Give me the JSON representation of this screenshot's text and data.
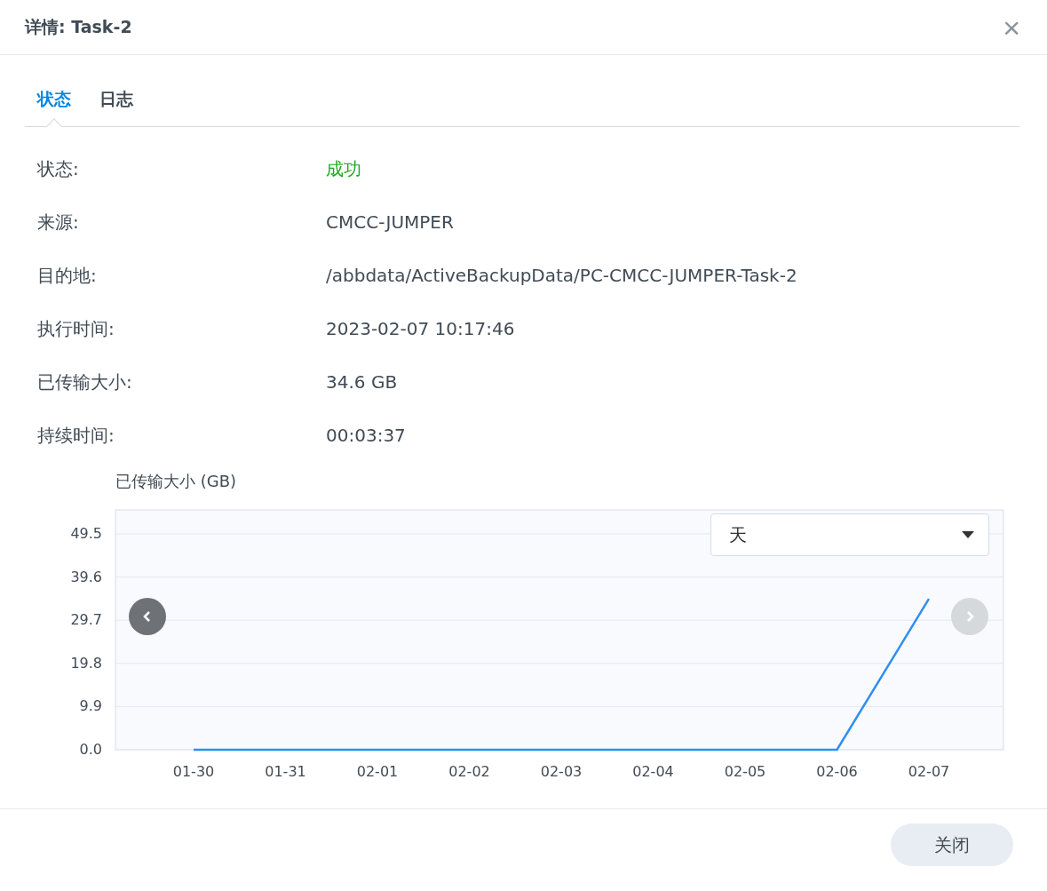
{
  "dialog": {
    "title": "详情: Task-2",
    "close_icon": "×"
  },
  "tabs": [
    {
      "label": "状态",
      "selected": true
    },
    {
      "label": "日志",
      "selected": false
    }
  ],
  "details": [
    {
      "label": "状态:",
      "value": "成功",
      "kind": "status"
    },
    {
      "label": "来源:",
      "value": "CMCC-JUMPER",
      "kind": "plain"
    },
    {
      "label": "目的地:",
      "value": "/abbdata/ActiveBackupData/PC-CMCC-JUMPER-Task-2",
      "kind": "plain"
    },
    {
      "label": "执行时间:",
      "value": "2023-02-07 10:17:46",
      "kind": "plain"
    },
    {
      "label": "已传输大小:",
      "value": "34.6 GB",
      "kind": "plain"
    },
    {
      "label": "持续时间:",
      "value": "00:03:37",
      "kind": "plain"
    }
  ],
  "chart": {
    "period_dropdown": {
      "value": "天"
    },
    "prev_button": {
      "disabled": false
    },
    "next_button": {
      "disabled": true
    },
    "chart_data": {
      "type": "line",
      "ylabel": "已传输大小 (GB)",
      "categories": [
        "01-30",
        "01-31",
        "02-01",
        "02-02",
        "02-03",
        "02-04",
        "02-05",
        "02-06",
        "02-07"
      ],
      "grid": true,
      "series": [
        {
          "color": "#2f8ff0",
          "values": [
            0,
            0,
            0,
            0,
            0,
            0,
            0,
            0,
            34.6
          ]
        }
      ],
      "ylim": [
        0,
        55
      ],
      "yticks": [
        {
          "value": 0,
          "label": "0.0"
        },
        {
          "value": 9.9,
          "label": "9.9"
        },
        {
          "value": 19.8,
          "label": "19.8"
        },
        {
          "value": 29.7,
          "label": "29.7"
        },
        {
          "value": 39.6,
          "label": "39.6"
        },
        {
          "value": 49.5,
          "label": "49.5"
        }
      ]
    }
  },
  "footer": {
    "close_button": "关闭"
  }
}
